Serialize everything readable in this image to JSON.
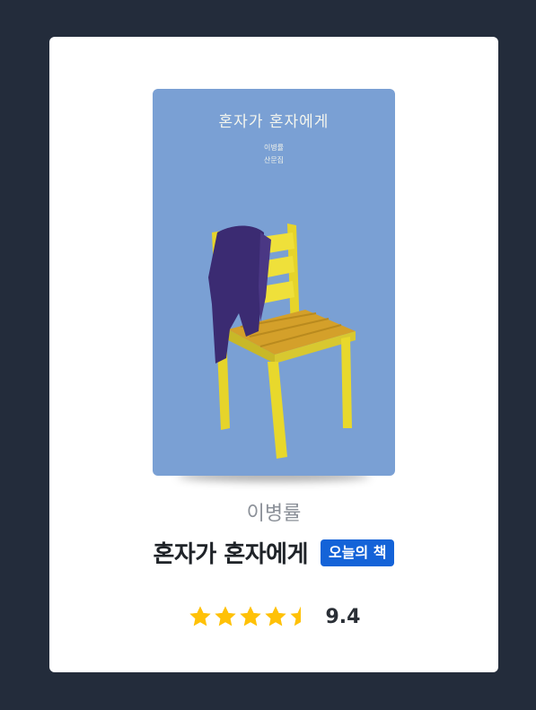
{
  "book": {
    "cover": {
      "title": "혼자가 혼자에게",
      "author": "이병률",
      "genre": "산문집",
      "background_color": "#7aa0d4"
    },
    "author": "이병률",
    "title": "혼자가 혼자에게",
    "badge": "오늘의 책",
    "rating": {
      "stars_filled": 4.5,
      "stars_total": 5,
      "score": "9.4",
      "star_color": "#ffc107",
      "star_empty_color": "#dcdcdc"
    }
  },
  "colors": {
    "page_background": "#232c3b",
    "card_background": "#ffffff",
    "badge_background": "#1463d8"
  },
  "icons": {
    "star": "star-icon"
  }
}
